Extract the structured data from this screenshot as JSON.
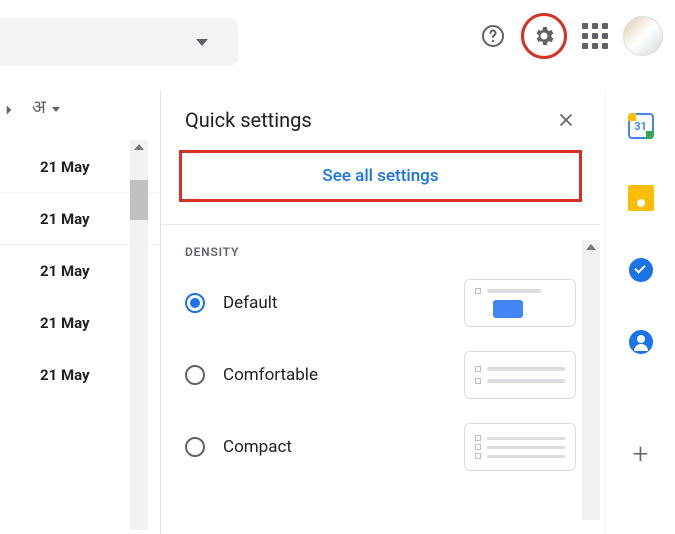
{
  "topbar": {
    "search_caret": "▾"
  },
  "left": {
    "lang_label": "अ",
    "dates": [
      "21 May",
      "21 May",
      "21 May",
      "21 May",
      "21 May"
    ]
  },
  "panel": {
    "title": "Quick settings",
    "see_all": "See all settings",
    "section_density": "DENSITY",
    "density": {
      "options": [
        {
          "label": "Default",
          "selected": true
        },
        {
          "label": "Comfortable",
          "selected": false
        },
        {
          "label": "Compact",
          "selected": false
        }
      ]
    }
  },
  "side": {
    "calendar_day": "31"
  }
}
